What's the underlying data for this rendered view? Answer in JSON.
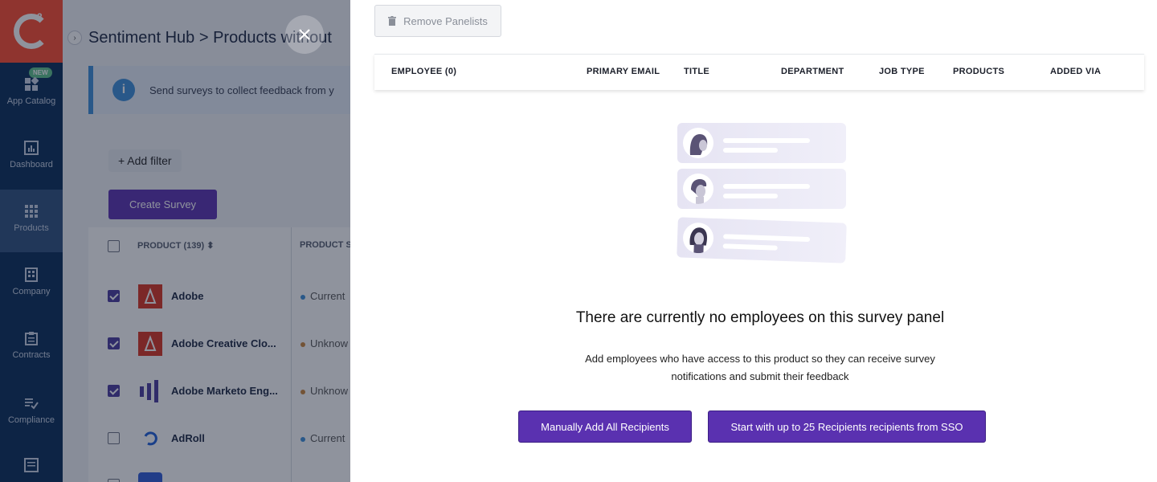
{
  "background": {
    "sidebar": {
      "new_badge": "NEW",
      "items": [
        {
          "label": "App Catalog",
          "icon": "app-catalog-icon"
        },
        {
          "label": "Dashboard",
          "icon": "dashboard-icon"
        },
        {
          "label": "Products",
          "icon": "products-grid-icon"
        },
        {
          "label": "Company",
          "icon": "company-building-icon"
        },
        {
          "label": "Contracts",
          "icon": "contracts-clipboard-icon"
        },
        {
          "label": "Compliance",
          "icon": "compliance-list-icon"
        }
      ]
    },
    "breadcrumb": "Sentiment Hub > Products without",
    "banner_text": "Send surveys to collect feedback from y",
    "add_filter_label": "+ Add filter",
    "create_survey_label": "Create Survey",
    "table": {
      "col_product": "PRODUCT (139)",
      "col_status": "PRODUCT S",
      "rows": [
        {
          "name": "Adobe",
          "status": "Current",
          "checked": true
        },
        {
          "name": "Adobe Creative Clo...",
          "status": "Unknow",
          "checked": true
        },
        {
          "name": "Adobe Marketo Eng...",
          "status": "Unknow",
          "checked": true
        },
        {
          "name": "AdRoll",
          "status": "Current",
          "checked": false
        }
      ]
    }
  },
  "drawer": {
    "remove_label": "Remove Panelists",
    "columns": [
      "EMPLOYEE (0)",
      "PRIMARY EMAIL",
      "TITLE",
      "DEPARTMENT",
      "JOB TYPE",
      "PRODUCTS",
      "ADDED VIA"
    ],
    "empty_title": "There are currently no employees on this survey panel",
    "empty_desc": "Add employees who have access to this product so they can receive survey notifications and submit their feedback",
    "btn_manual": "Manually Add All Recipients",
    "btn_sso": "Start with up to 25 Recipients recipients from SSO"
  },
  "colors": {
    "sidebar": "#062b56",
    "brand": "#ff492c",
    "primary_button": "#5a31b0",
    "illustration": "#e6e4f3"
  }
}
